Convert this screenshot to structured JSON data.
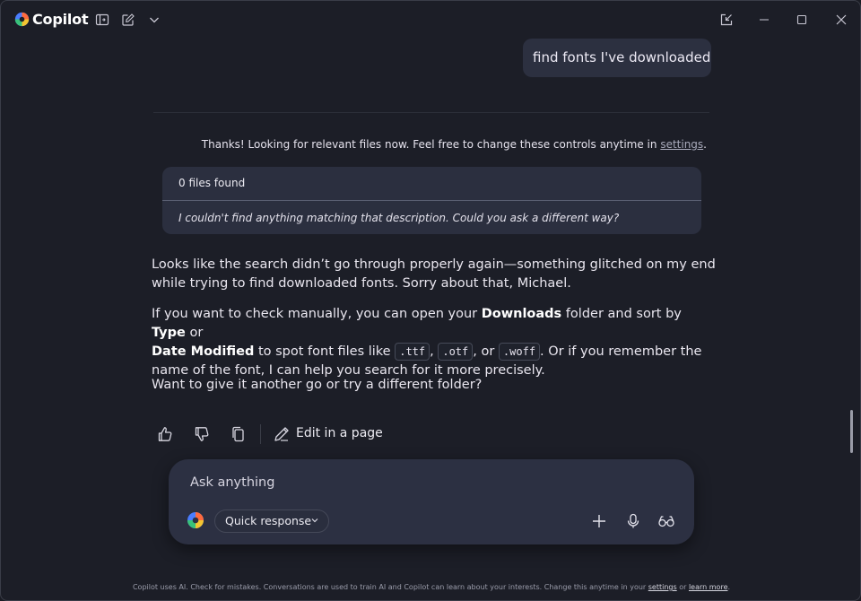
{
  "app": {
    "title": "Copilot"
  },
  "user_message": "find fonts I've downloaded",
  "status": {
    "text": "Thanks! Looking for relevant files now. Feel free to change these controls anytime in ",
    "link": "settings",
    "end": "."
  },
  "files_card": {
    "header": "0 files found",
    "body": "I couldn't find anything matching that description. Could you ask a different way?"
  },
  "reply": {
    "p1": "Looks like the search didn’t go through properly again—something glitched on my end while trying to find downloaded fonts. Sorry about that, Michael.",
    "p2_a": "If you want to check manually, you can open your ",
    "p2_downloads": "Downloads",
    "p2_b": " folder and sort by ",
    "p2_type": "Type",
    "p2_c": " or ",
    "p2_date": "Date Modified",
    "p2_d": " to spot font files like ",
    "ext_ttf": ".ttf",
    "p2_comma1": ", ",
    "ext_otf": ".otf",
    "p2_or": ", or ",
    "ext_woff": ".woff",
    "p2_e": ". Or if you remember the name of the font, I can help you search for it more precisely.",
    "p3": "Want to give it another go or try a different folder?"
  },
  "actions": {
    "edit_label": "Edit in a page"
  },
  "composer": {
    "placeholder": "Ask anything",
    "mode": "Quick response"
  },
  "footer": {
    "text": "Copilot uses AI. Check for mistakes. Conversations are used to train AI and Copilot can learn about your interests. Change this anytime in your ",
    "settings": "settings",
    "or": " or ",
    "learn_more": "learn more",
    "end": "."
  },
  "icons": {
    "logo": "copilot-logo",
    "sidebar": "sidebar-toggle-icon",
    "new_chat": "new-chat-icon",
    "dropdown": "chevron-down-icon",
    "popout": "popout-icon",
    "minimize": "minimize-icon",
    "maximize": "maximize-icon",
    "close": "close-icon",
    "thumbs_up": "thumbs-up-icon",
    "thumbs_down": "thumbs-down-icon",
    "copy": "copy-icon",
    "edit": "edit-pen-icon",
    "plus": "plus-icon",
    "mic": "microphone-icon",
    "vision": "glasses-icon"
  },
  "colors": {
    "background": "#1c1e27",
    "bubble": "#2c3040",
    "card": "#2b2f3f",
    "composer": "#2c3042",
    "text": "#e9e6ef"
  }
}
